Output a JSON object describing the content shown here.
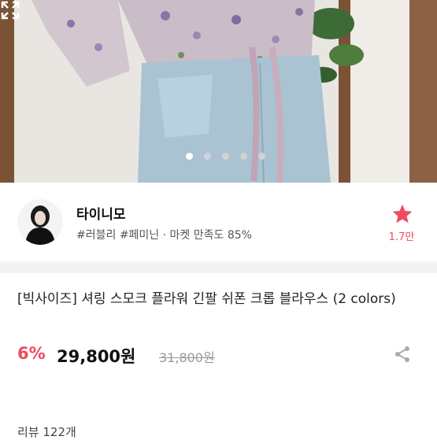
{
  "gallery": {
    "slide_count": 5,
    "active_index": 0
  },
  "seller": {
    "name": "타이니모",
    "tags": "#러블리 #페미닌 · 마켓 만족도 85%",
    "favorite_count": "1.7만"
  },
  "product": {
    "title": "[빅사이즈] 셔링 스모크 플라워 긴팔 쉬폰 크롭 블라우스 (2 colors)",
    "discount": "6%",
    "price": "29,800원",
    "original_price": "31,800원"
  },
  "reviews_label": "리뷰 122개",
  "colors": {
    "accent": "#ef4a5f"
  }
}
